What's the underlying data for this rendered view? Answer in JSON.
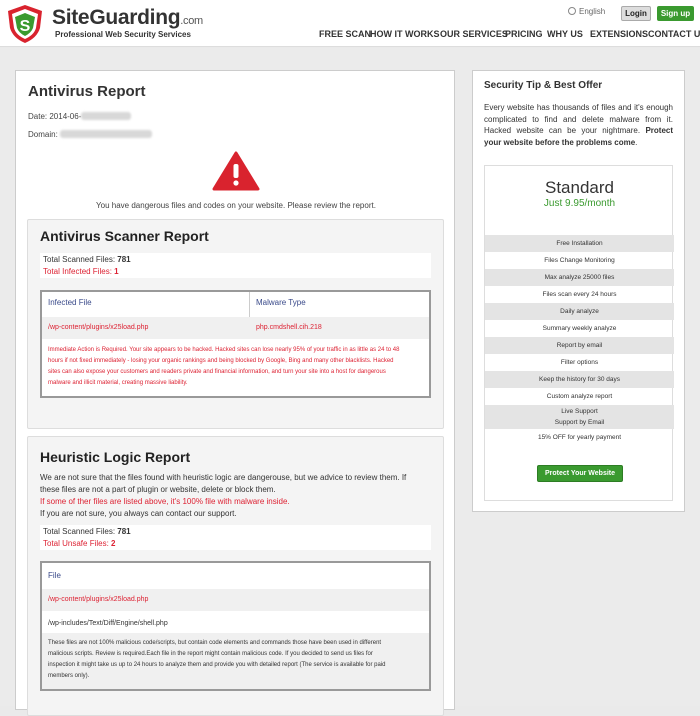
{
  "header": {
    "brand": "SiteGuarding",
    "brand_suffix": ".com",
    "tagline": "Professional Web Security Services",
    "language": "English",
    "login_label": "Login",
    "signup_label": "Sign up",
    "nav": [
      "FREE SCAN",
      "HOW IT WORKS",
      "OUR SERVICES",
      "PRICING",
      "WHY US",
      "EXTENSIONS",
      "CONTACT US"
    ]
  },
  "report": {
    "title": "Antivirus Report",
    "date_label": "Date: 2014-06-",
    "domain_label": "Domain:",
    "warning_message": "You have dangerous files and codes on your website. Please review the report."
  },
  "scanner": {
    "title": "Antivirus Scanner Report",
    "total_scanned_label": "Total Scanned Files:",
    "total_scanned_value": "781",
    "total_infected_label": "Total Infected Files:",
    "total_infected_value": "1",
    "col_file": "Infected File",
    "col_malware": "Malware Type",
    "rows": [
      {
        "file": "/wp-content/plugins/x25load.php",
        "malware": "php.cmdshell.cih.218"
      }
    ],
    "note_lines": [
      "Immediate Action is Required. Your site appears to be hacked. Hacked sites can lose nearly 95% of your traffic in as little as 24 to 48",
      "hours if not fixed immediately - losing your organic rankings and being blocked by Google, Bing and many other blacklists. Hacked",
      "sites can also expose your customers and readers private and financial information, and turn your site into a host for dangerous",
      "malware and illicit material, creating massive liability."
    ]
  },
  "heuristic": {
    "title": "Heuristic Logic Report",
    "intro_lines": [
      "We are not sure that the files found with heuristic logic are dangerouse, but we advice to review them. If",
      "these files are not a part of plugin or website, delete or block them."
    ],
    "warning_line": "If some of ther files are listed above, it's 100% file with malware inside.",
    "contact_line": "If you are not sure, you always can contact our support.",
    "total_scanned_label": "Total Scanned Files:",
    "total_scanned_value": "781",
    "total_unsafe_label": "Total Unsafe Files:",
    "total_unsafe_value": "2",
    "col_file": "File",
    "files": [
      "/wp-content/plugins/x25load.php",
      "/wp-includes/Text/Diff/Engine/shell.php"
    ],
    "note_lines": [
      "These files are not 100% malicious code/scripts, but contain code elements and commands those have been used in different",
      "malicious scripts. Review is required.Each file in the report might contain malicious code. If you decided to send us files for",
      "inspection it might take us up to 24 hours to analyze them and provide you with detailed report (The service is available for paid",
      "members only)."
    ]
  },
  "sidebar": {
    "title": "Security Tip & Best Offer",
    "tip_text": "Every website has thousands of files and it's enough complicated to find and delete malware from it. Hacked website can be your nightmare.",
    "tip_bold": "Protect your website before the problems come",
    "tip_end": ".",
    "plan_name": "Standard",
    "plan_price": "Just 9.95/month",
    "features": [
      "Free Installation",
      "Files Change Monitoring",
      "Max analyze 25000 files",
      "Files scan every 24 hours",
      "Daily analyze",
      "Summary weekly analyze",
      "Report by email",
      "Filter options",
      "Keep the history for 30 days",
      "Custom analyze report",
      "Live Support",
      "Support by Email",
      "15% OFF for yearly payment"
    ],
    "cta_label": "Protect Your Website"
  }
}
